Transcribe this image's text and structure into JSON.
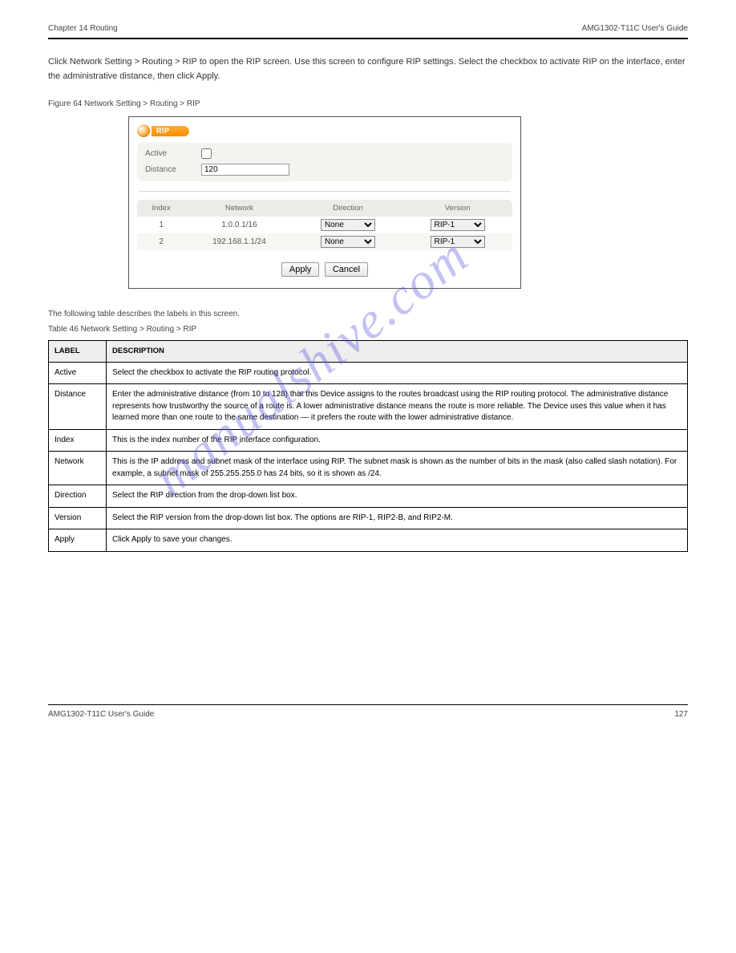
{
  "header": {
    "left": "Chapter 14 Routing",
    "right": "AMG1302-T11C User's Guide"
  },
  "intro": "Click Network Setting > Routing > RIP to open the RIP screen. Use this screen to configure RIP settings. Select the checkbox to activate RIP on the interface, enter the administrative distance, then click Apply.",
  "figure_title": "Figure 64  Network Setting > Routing > RIP",
  "rip_panel": {
    "badge": "RIP",
    "active_label": "Active",
    "active_checked": false,
    "distance_label": "Distance",
    "distance_value": "120",
    "columns": {
      "index": "Index",
      "network": "Network",
      "direction": "Direction",
      "version": "Version"
    },
    "rows": [
      {
        "index": "1",
        "network": "1.0.0.1/16",
        "direction": "None",
        "version": "RIP-1"
      },
      {
        "index": "2",
        "network": "192.168.1.1/24",
        "direction": "None",
        "version": "RIP-1"
      }
    ],
    "apply": "Apply",
    "cancel": "Cancel"
  },
  "desc_table_title": "The following table describes the labels in this screen.",
  "desc_table_caption": "Table 46   Network Setting > Routing > RIP",
  "desc_header": {
    "label": "LABEL",
    "description": "DESCRIPTION"
  },
  "desc_rows": [
    {
      "label": "Active",
      "desc": "Select the checkbox to activate the RIP routing protocol."
    },
    {
      "label": "Distance",
      "desc": "Enter the administrative distance (from 10 to 128) that this Device assigns to the routes broadcast using the RIP routing protocol. The administrative distance represents how trustworthy the source of a route is. A lower administrative distance means the route is more reliable. The Device uses this value when it has learned more than one route to the same destination — it prefers the route with the lower administrative distance."
    },
    {
      "label": "Index",
      "desc": "This is the index number of the RIP interface configuration."
    },
    {
      "label": "Network",
      "desc": "This is the IP address and subnet mask of the interface using RIP. The subnet mask is shown as the number of bits in the mask (also called slash notation). For example, a subnet mask of 255.255.255.0 has 24 bits, so it is shown as /24."
    },
    {
      "label": "Direction",
      "desc": "Select the RIP direction from the drop-down list box."
    },
    {
      "label": "Version",
      "desc": "Select the RIP version from the drop-down list box. The options are RIP-1, RIP2-B, and RIP2-M."
    },
    {
      "label": "Apply",
      "desc": "Click Apply to save your changes."
    }
  ],
  "footer": {
    "left": "AMG1302-T11C User's Guide",
    "right": "127"
  },
  "watermark": "manualshive.com"
}
